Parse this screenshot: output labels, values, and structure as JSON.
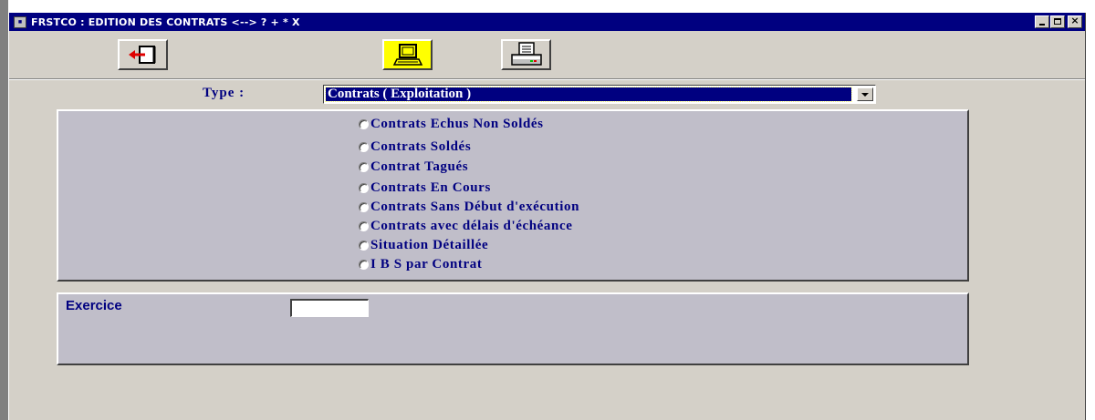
{
  "window": {
    "title": "FRSTCO : EDITION DES CONTRATS <--> ? + * X",
    "app_icon": "app-icon",
    "controls": {
      "minimize": "minimize-icon",
      "maximize": "maximize-icon",
      "close_glyph": "×"
    }
  },
  "toolbar": {
    "buttons": [
      {
        "name": "exit",
        "icon": "exit-door-icon"
      },
      {
        "name": "screen",
        "icon": "computer-screen-icon",
        "bg": "#ffff00"
      },
      {
        "name": "print",
        "icon": "printer-icon"
      }
    ]
  },
  "type": {
    "label": "Type :",
    "selected": "Contrats ( Exploitation )"
  },
  "options": [
    "Contrats Echus Non Soldés",
    "Contrats Soldés",
    "Contrat Tagués",
    "Contrats En Cours",
    "Contrats Sans Début d'exécution",
    "Contrats avec délais d'échéance",
    "Situation Détaillée",
    "I B S  par Contrat"
  ],
  "exercice": {
    "label": "Exercice",
    "value": ""
  },
  "colors": {
    "titlebar": "#000080",
    "window_bg": "#d4d0c8",
    "panel_bg": "#c0bec9",
    "label_text": "#000080",
    "highlight": "#ffff00"
  }
}
